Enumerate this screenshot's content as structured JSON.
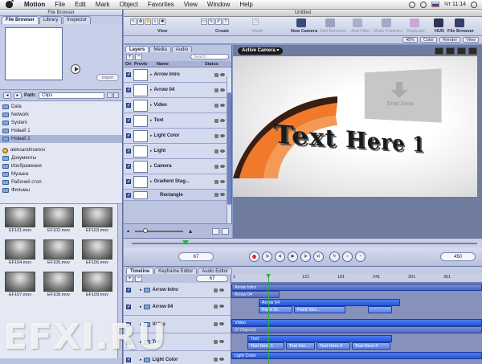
{
  "menubar": {
    "app": "Motion",
    "items": [
      "File",
      "Edit",
      "Mark",
      "Object",
      "Favorites",
      "View",
      "Window",
      "Help"
    ],
    "clock": "Чт 11:14"
  },
  "file_browser": {
    "title": "File Browser",
    "tabs": [
      "File Browser",
      "Library",
      "Inspector"
    ],
    "import_label": "Import",
    "path_label": "Path:",
    "path_value": "Clips",
    "folders": [
      {
        "label": "Data",
        "icon": "folder-icon"
      },
      {
        "label": "Network",
        "icon": "folder-icon"
      },
      {
        "label": "System",
        "icon": "folder-icon"
      },
      {
        "label": "Новый 1",
        "icon": "folder-icon"
      },
      {
        "label": "Новый 2",
        "icon": "folder-icon"
      },
      {
        "label": "aleksandrivanov",
        "icon": "user-icon"
      },
      {
        "label": "Документы",
        "icon": "folder-icon"
      },
      {
        "label": "Изображения",
        "icon": "folder-icon"
      },
      {
        "label": "Музыка",
        "icon": "folder-icon"
      },
      {
        "label": "Рабочий стол",
        "icon": "folder-icon"
      },
      {
        "label": "Фильмы",
        "icon": "folder-icon"
      }
    ],
    "selected_folder": "Новый 2",
    "thumbnails": [
      "EF101.mov",
      "EF102.mov",
      "EF103.mov",
      "EF104.mov",
      "EF105.mov",
      "EF106.mov",
      "EF107.mov",
      "EF108.mov",
      "EF109.mov"
    ]
  },
  "window": {
    "title": "Untitled",
    "toolbar_captions": {
      "view": "View",
      "create": "Create",
      "mask": "Mask",
      "new_camera": "New Camera",
      "add_behavior": "Add Behavior",
      "add_filter": "Add Filter",
      "make_particles": "Make Particles",
      "replicate": "Replicate",
      "hud": "HUD",
      "file_browser": "File Browser"
    },
    "subbar": {
      "zoom": "45%",
      "channel": "Color",
      "render": "Render",
      "view": "View"
    }
  },
  "layers_panel": {
    "tabs": [
      "Layers",
      "Media",
      "Audio"
    ],
    "search_placeholder": "Search",
    "columns": {
      "on": "On",
      "preview": "Previe",
      "name": "Name",
      "status": "Status"
    },
    "rows": [
      {
        "name": "Arrow Intro",
        "sub": false
      },
      {
        "name": "Arrow 04",
        "sub": false
      },
      {
        "name": "Video",
        "sub": false
      },
      {
        "name": "Text",
        "sub": false
      },
      {
        "name": "Light Color",
        "sub": false
      },
      {
        "name": "Light",
        "sub": false
      },
      {
        "name": "Camera",
        "sub": false
      },
      {
        "name": "Gradient Stag...",
        "sub": false
      },
      {
        "name": "Rectangle",
        "sub": true
      }
    ]
  },
  "canvas": {
    "camera_menu": "Active Camera ▾",
    "drop_zone_text": "Drop Zone",
    "headline": "Text Here 1"
  },
  "transport": {
    "left_timecode": "67",
    "right_timecode": "450"
  },
  "timeline": {
    "tabs": [
      "Timeline",
      "Keyframe Editor",
      "Audio Editor"
    ],
    "timecode": "67",
    "ruler_ticks": [
      "1",
      "121",
      "181",
      "241",
      "301",
      "361"
    ],
    "rows": [
      "Arrow Intro",
      "Arrow 04",
      "Video",
      "Text",
      "Light Color"
    ],
    "bars": {
      "arrow_intro": "Arrow Intro",
      "arrow_intro_sub": "Arrow 04",
      "arrow04": "Arrow 04",
      "paint1": "Paint St..",
      "paint2": "Paint Stro...",
      "video": "Video",
      "video_sub": "(2 Objects)",
      "text": "Text",
      "text1": "Text Here 1",
      "text2": "Text Her...",
      "text3": "Text Here 3",
      "text4": "Text Here 4",
      "light_color": "Light Color"
    }
  },
  "watermark": "EFXI.RU"
}
